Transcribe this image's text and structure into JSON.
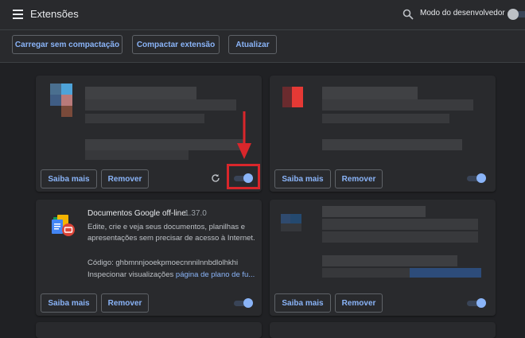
{
  "header": {
    "title": "Extensões",
    "dev_mode_label": "Modo do desenvolvedor"
  },
  "toolbar": {
    "load_unpacked": "Carregar sem compactação",
    "pack_extension": "Compactar extensão",
    "update": "Atualizar"
  },
  "cards": [
    {
      "details_label": "Saiba mais",
      "remove_label": "Remover",
      "enabled": true
    },
    {
      "details_label": "Saiba mais",
      "remove_label": "Remover",
      "enabled": true
    },
    {
      "name": "Documentos Google off-line",
      "version": "1.37.0",
      "description_line1": "Edite, crie e veja seus documentos, planilhas e",
      "description_line2": "apresentações sem precisar de acesso à Internet.",
      "code_label": "Código: ghbmnnjooekpmoecnnnilnnbdlolhkhi",
      "inspect_label": "Inspecionar visualizações",
      "inspect_link": "página de plano de fu...",
      "details_label": "Saiba mais",
      "remove_label": "Remover",
      "enabled": true
    },
    {
      "details_label": "Saiba mais",
      "remove_label": "Remover",
      "enabled": true
    }
  ],
  "colors": {
    "accent": "#8ab4f8",
    "annotation": "#d9262b",
    "background": "#202124",
    "surface": "#292a2d"
  },
  "icons": [
    "menu-icon",
    "search-icon",
    "reload-icon",
    "google-docs-offline-icon",
    "arrow-annotation"
  ]
}
